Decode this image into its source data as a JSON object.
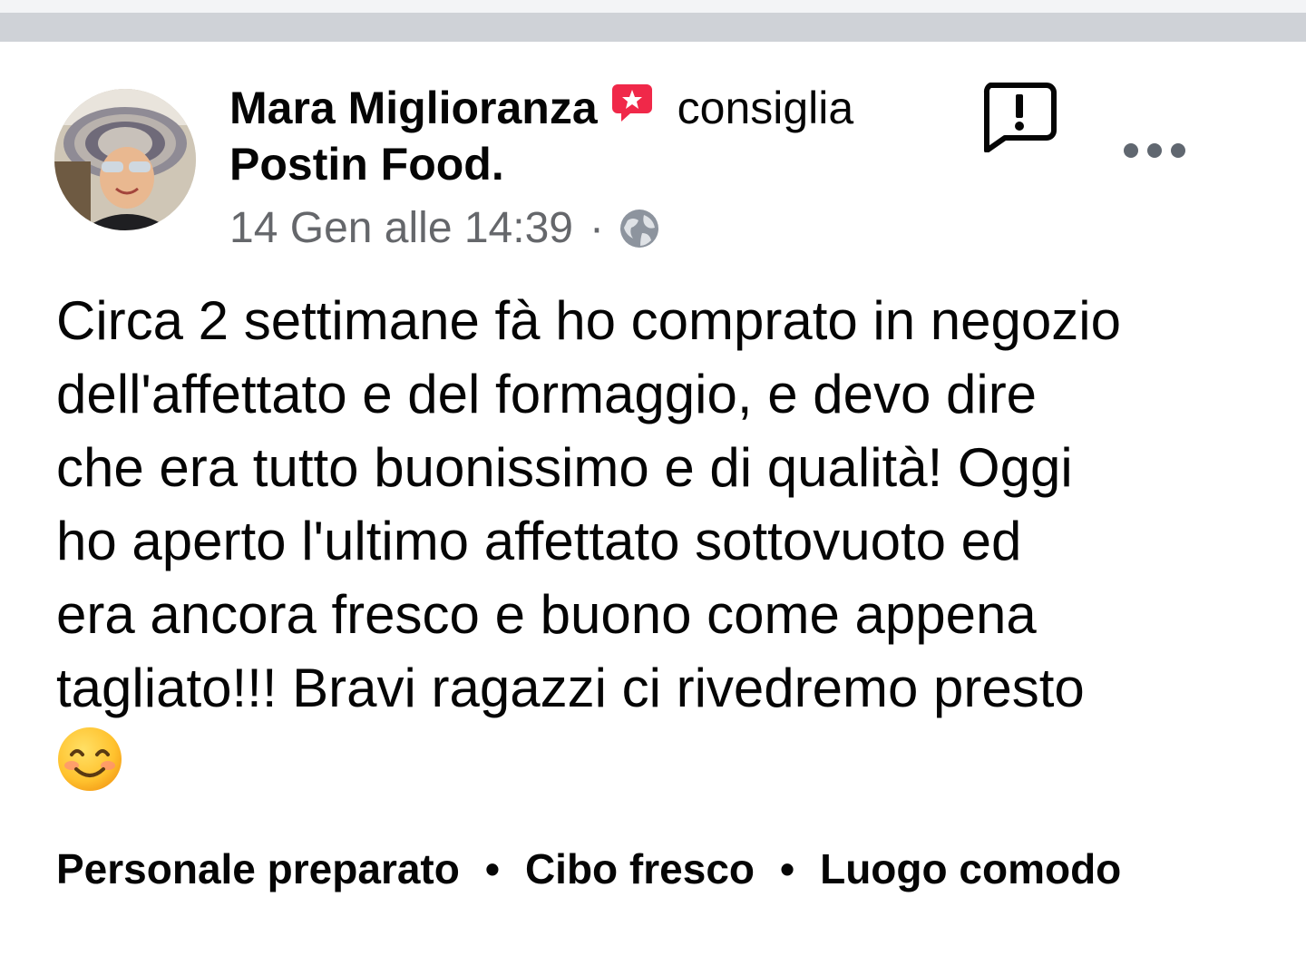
{
  "post": {
    "author": "Mara Miglioranza",
    "verb": "consiglia",
    "page": "Postin Food.",
    "timestamp": "14 Gen alle 14:39",
    "separator": "·",
    "privacy_icon": "globe-icon",
    "badge_icon": "recommend-badge-icon",
    "report_icon": "report-flag-icon",
    "more_icon": "more-options-icon",
    "body": "Circa 2 settimane fà ho comprato in negozio\ndell'affettato e del formaggio,    e devo dire\nche era tutto buonissimo e di qualità! Oggi\nho aperto l'ultimo affettato sottovuoto ed\nera ancora fresco e buono come appena\ntagliato!!! Bravi ragazzi ci rivedremo presto",
    "emoji": "smiling-face-icon",
    "tags": [
      "Personale preparato",
      "Cibo fresco",
      "Luogo comodo"
    ],
    "tag_separator": "•"
  },
  "colors": {
    "badge": "#f02849",
    "meta_text": "#65676b",
    "divider": "#cfd2d7"
  }
}
